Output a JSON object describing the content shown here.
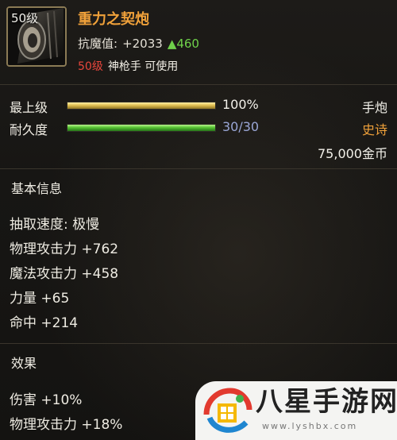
{
  "item": {
    "level_badge": "50级",
    "name": "重力之契炮",
    "magic_resist_label": "抗魔值:",
    "magic_resist_value": "+2033",
    "magic_resist_up": "▲460",
    "requirement_level": "50级",
    "requirement_text": "神枪手 可使用",
    "type": "手炮",
    "rarity": "史诗",
    "price": "75,000金币",
    "icon": "cannon-icon"
  },
  "stats": {
    "top_level": {
      "label": "最上级",
      "value_text": "100%",
      "fill_percent": 100
    },
    "durability": {
      "label": "耐久度",
      "value_text": "30/30",
      "fill_percent": 100
    }
  },
  "basic_info": {
    "heading": "基本信息",
    "lines": [
      "抽取速度: 极慢",
      "物理攻击力 +762",
      "魔法攻击力 +458",
      "力量 +65",
      "命中 +214"
    ]
  },
  "effects": {
    "heading": "效果",
    "lines": [
      "伤害 +10%",
      "物理攻击力 +18%"
    ]
  },
  "watermark": {
    "name": "八星手游网",
    "url": "www.lyshbx.com"
  },
  "colors": {
    "title": "#f0a13a",
    "rarity": "#f0a13a",
    "increase": "#6fd14a",
    "requirement_level": "#e8463c",
    "durability_text": "#9aa6d6"
  }
}
